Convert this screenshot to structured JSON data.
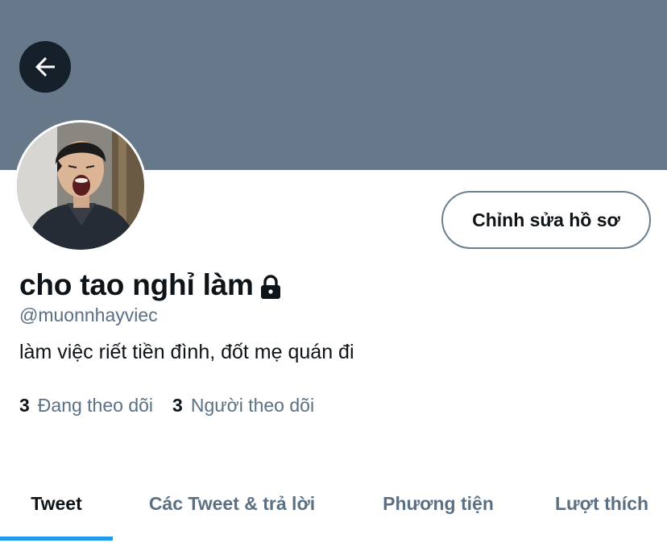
{
  "header": {
    "back_icon": "arrow-left-icon"
  },
  "profile": {
    "display_name": "cho tao nghỉ làm",
    "protected_icon": "lock-icon",
    "handle": "@muonnhayviec",
    "bio": "làm việc riết tiền đình, đốt mẹ quán đi",
    "edit_button_label": "Chỉnh sửa hồ sơ",
    "following_count": "3",
    "following_label": "Đang theo dõi",
    "followers_count": "3",
    "followers_label": "Người theo dõi"
  },
  "tabs": [
    {
      "label": "Tweet",
      "active": true
    },
    {
      "label": "Các Tweet & trả lời",
      "active": false
    },
    {
      "label": "Phương tiện",
      "active": false
    },
    {
      "label": "Lượt thích",
      "active": false
    }
  ],
  "colors": {
    "banner": "#66788a",
    "accent": "#1d9bf0",
    "text_primary": "#0f1419",
    "text_secondary": "#5b7083"
  }
}
